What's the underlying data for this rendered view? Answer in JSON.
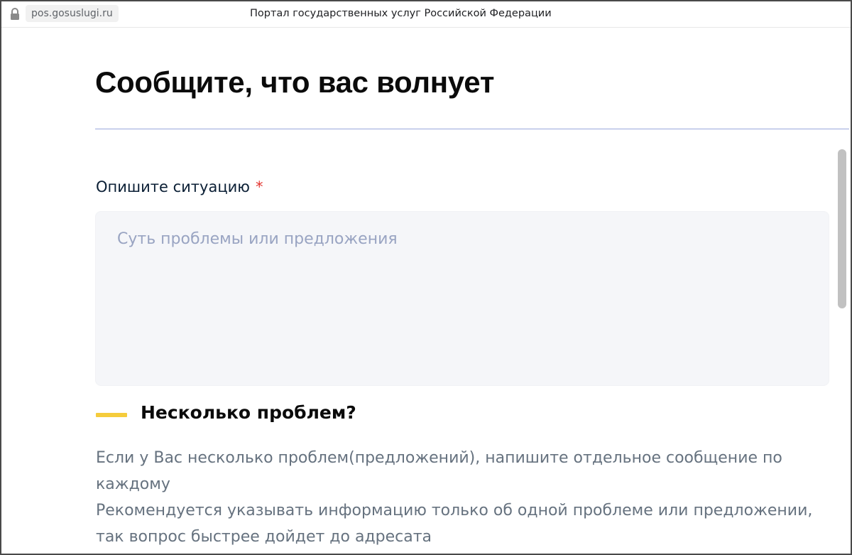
{
  "topbar": {
    "url": "pos.gosuslugi.ru",
    "title": "Портал государственных услуг Российской Федерации"
  },
  "page": {
    "title": "Сообщите, что вас волнует"
  },
  "form": {
    "label": "Опишите ситуацию",
    "required_mark": "*",
    "placeholder": "Суть проблемы или предложения",
    "value": ""
  },
  "hint": {
    "title": "Несколько проблем?",
    "paragraphs": [
      "Если у Вас несколько проблем(предложений), напишите отдельное сообщение по каждому",
      "Рекомендуется указывать информацию только об одной проблеме или предложении, так вопрос быстрее дойдет до адресата"
    ]
  },
  "colors": {
    "accent_bar": "#f5cc3c",
    "required": "#e3342f",
    "divider": "#9aa8dc",
    "field_bg": "#f5f6f9"
  },
  "icons": {
    "lock": "lock-icon"
  }
}
